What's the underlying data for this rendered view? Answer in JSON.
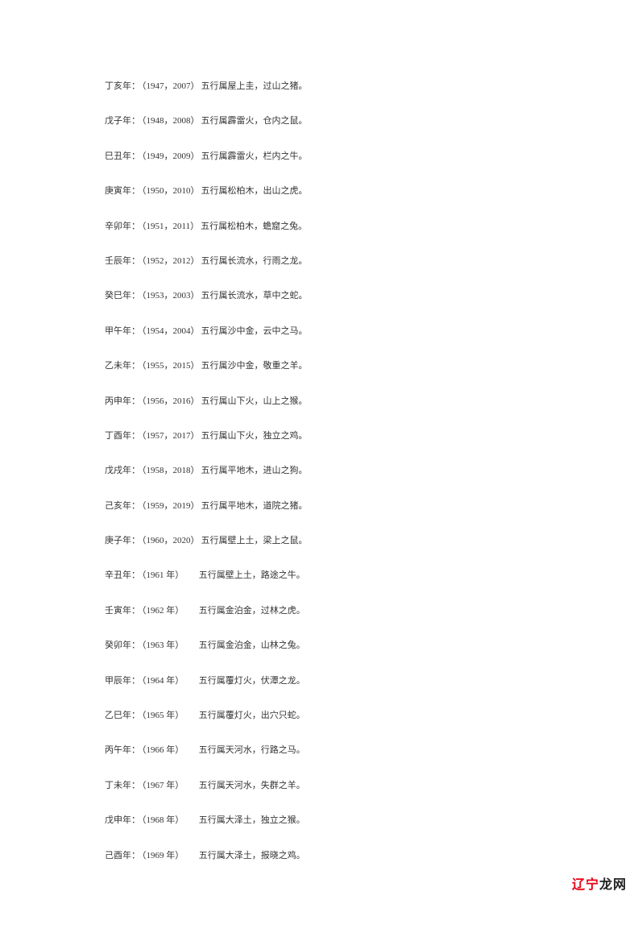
{
  "entries": [
    {
      "ganzhi": "丁亥年：",
      "years": "（1947，2007）",
      "desc": "五行属屋上圭，过山之猪。"
    },
    {
      "ganzhi": "戊子年：",
      "years": "（1948，2008）",
      "desc": "五行属霹雷火，仓内之鼠。"
    },
    {
      "ganzhi": "巳丑年：",
      "years": "（1949，2009）",
      "desc": "五行属霹雷火，栏内之牛。"
    },
    {
      "ganzhi": "庚寅年：",
      "years": "（1950，2010）",
      "desc": "五行属松柏木，出山之虎。"
    },
    {
      "ganzhi": "辛卯年：",
      "years": "（1951，2011）",
      "desc": "五行属松柏木，蟾窟之兔。"
    },
    {
      "ganzhi": "壬辰年：",
      "years": "（1952，2012）",
      "desc": "五行属长流水，行雨之龙。"
    },
    {
      "ganzhi": "癸巳年：",
      "years": "（1953，2003）",
      "desc": "五行属长流水，草中之蛇。"
    },
    {
      "ganzhi": "甲午年：",
      "years": "（1954，2004）",
      "desc": "五行属沙中金，云中之马。"
    },
    {
      "ganzhi": "乙未年：",
      "years": "（1955，2015）",
      "desc": "五行属沙中金，敬重之羊。"
    },
    {
      "ganzhi": "丙申年：",
      "years": "（1956，2016）",
      "desc": "五行属山下火，山上之猴。"
    },
    {
      "ganzhi": "丁酉年：",
      "years": "（1957，2017）",
      "desc": "五行属山下火，独立之鸡。"
    },
    {
      "ganzhi": "戊戌年：",
      "years": "（1958，2018）",
      "desc": "五行属平地木，进山之狗。"
    },
    {
      "ganzhi": "己亥年：",
      "years": "（1959，2019）",
      "desc": "五行属平地木，道院之猪。"
    },
    {
      "ganzhi": "庚子年：",
      "years": "（1960，2020）",
      "desc": "五行属壁上土，梁上之鼠。"
    },
    {
      "ganzhi": "辛丑年：",
      "years": "（1961 年）　　",
      "desc": "五行属壁上土，路途之牛。"
    },
    {
      "ganzhi": "壬寅年：",
      "years": "（1962 年）　　",
      "desc": "五行属金泊金，过林之虎。"
    },
    {
      "ganzhi": "癸卯年：",
      "years": "（1963 年）　　",
      "desc": "五行属金泊金，山林之兔。"
    },
    {
      "ganzhi": "甲辰年：",
      "years": "（1964 年）　　",
      "desc": "五行属覆灯火，伏潭之龙。"
    },
    {
      "ganzhi": "乙巳年：",
      "years": "（1965 年）　　",
      "desc": "五行属覆灯火，出穴只蛇。"
    },
    {
      "ganzhi": "丙午年：",
      "years": "（1966 年）　　",
      "desc": "五行属天河水，行路之马。"
    },
    {
      "ganzhi": "丁未年：",
      "years": "（1967 年）　　",
      "desc": "五行属天河水，失群之羊。"
    },
    {
      "ganzhi": "戊申年：",
      "years": "（1968 年）　　",
      "desc": "五行属大泽土，独立之猴。"
    },
    {
      "ganzhi": "己酉年：",
      "years": "（1969 年）　　",
      "desc": "五行属大泽土，报晓之鸡。"
    }
  ],
  "watermark": {
    "part1": "辽宁",
    "part2": "龙网"
  }
}
